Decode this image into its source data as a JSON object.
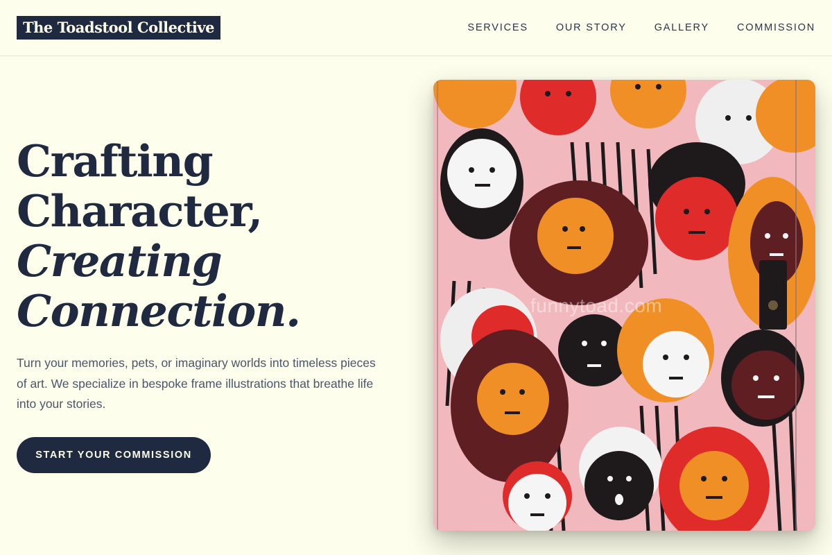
{
  "header": {
    "logo_text": "The Toadstool Collective",
    "nav": [
      {
        "label": "SERVICES"
      },
      {
        "label": "OUR STORY"
      },
      {
        "label": "GALLERY"
      },
      {
        "label": "COMMISSION"
      }
    ]
  },
  "hero": {
    "headline_lines": [
      "Crafting",
      "Character,",
      "Creating",
      "Connection."
    ],
    "subtext": "Turn your memories, pets, or imaginary worlds into timeless pieces of art. We specialize in bespoke frame illustrations that breathe life into your stories.",
    "cta_label": "START YOUR COMMISSION",
    "image_watermark": "funnytoad.com"
  },
  "colors": {
    "background": "#fefeed",
    "ink": "#1f2a40",
    "muted_text": "#4a5568"
  }
}
